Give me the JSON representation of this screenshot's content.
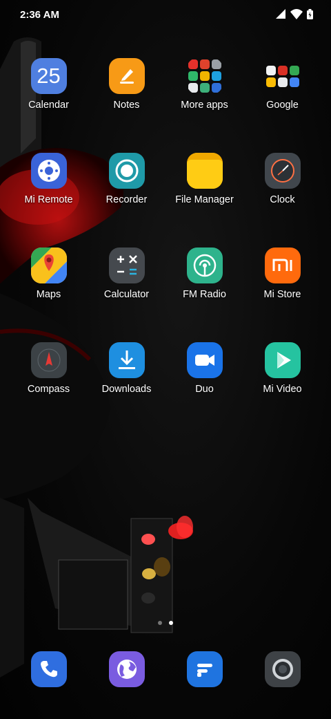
{
  "status": {
    "time": "2:36 AM"
  },
  "pages": {
    "count": 2,
    "active": 1
  },
  "apps": [
    [
      {
        "label": "Calendar",
        "icon": "calendar-icon",
        "day": "25"
      },
      {
        "label": "Notes",
        "icon": "pencil-icon"
      },
      {
        "label": "More apps",
        "icon": "folder-icon"
      },
      {
        "label": "Google",
        "icon": "folder-icon"
      }
    ],
    [
      {
        "label": "Mi Remote",
        "icon": "remote-icon"
      },
      {
        "label": "Recorder",
        "icon": "record-icon"
      },
      {
        "label": "File Manager",
        "icon": "folder-file-icon"
      },
      {
        "label": "Clock",
        "icon": "clock-icon"
      }
    ],
    [
      {
        "label": "Maps",
        "icon": "map-pin-icon"
      },
      {
        "label": "Calculator",
        "icon": "calculator-icon"
      },
      {
        "label": "FM Radio",
        "icon": "radio-icon"
      },
      {
        "label": "Mi Store",
        "icon": "mi-logo-icon"
      }
    ],
    [
      {
        "label": "Compass",
        "icon": "compass-icon"
      },
      {
        "label": "Downloads",
        "icon": "download-icon"
      },
      {
        "label": "Duo",
        "icon": "video-camera-icon"
      },
      {
        "label": "Mi Video",
        "icon": "play-icon"
      }
    ]
  ],
  "dock": [
    "phone-icon",
    "browser-icon",
    "messaging-icon",
    "camera-icon"
  ]
}
